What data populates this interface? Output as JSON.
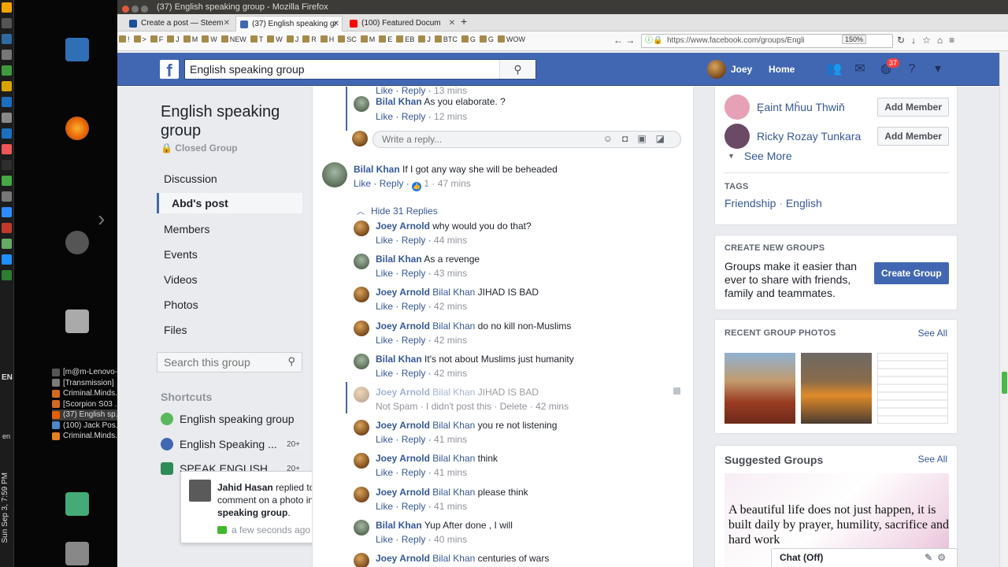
{
  "os": {
    "clock": "Sun Sep 3, 7:59 PM",
    "language": "EN",
    "lang_small": "en",
    "taskbar": [
      {
        "label": "[m@m-Lenovo-...",
        "color": "#555555"
      },
      {
        "label": "[Transmission]",
        "color": "#7a7a7a"
      },
      {
        "label": "Criminal.Minds...",
        "color": "#d2691e"
      },
      {
        "label": "[Scorpion S03 ...",
        "color": "#d2691e"
      },
      {
        "label": "(37) English sp...",
        "color": "#e66000"
      },
      {
        "label": "(100) Jack Pos...",
        "color": "#4f86c6"
      },
      {
        "label": "Criminal.Minds...",
        "color": "#e67e22"
      }
    ]
  },
  "window": {
    "title": "(37) English speaking group - Mozilla Firefox"
  },
  "tabs": [
    {
      "label": "Create a post — Steem",
      "color": "#1a5099"
    },
    {
      "label": "(37) English speaking gr",
      "color": "#4267b2"
    },
    {
      "label": "(100) Featured Docum",
      "color": "#ff0000"
    }
  ],
  "bookmarks": [
    "!",
    ">",
    "F",
    "J",
    "M",
    "W",
    "NEW",
    "T",
    "W",
    "J",
    "R",
    "H",
    "SC",
    "M",
    "E",
    "EB",
    "J",
    "BTC",
    "G",
    "G",
    "WOW"
  ],
  "url": "https://www.facebook.com/groups/Engli",
  "zoom": "150%",
  "fb": {
    "logo": "f",
    "search_value": "English speaking group",
    "user_name": "Joey",
    "home_label": "Home",
    "notifications_count": "37"
  },
  "group": {
    "name": "English speaking group",
    "type": "Closed Group",
    "nav": [
      "Discussion",
      "Abd's post",
      "Members",
      "Events",
      "Videos",
      "Photos",
      "Files"
    ],
    "active_nav": "Abd's post",
    "search_placeholder": "Search this group",
    "shortcuts_title": "Shortcuts",
    "shortcuts": [
      {
        "label": "English speaking group",
        "count": ""
      },
      {
        "label": "English Speaking ...",
        "count": "20+"
      },
      {
        "label": "SPEAK ENGLISH ...",
        "count": "20+"
      }
    ]
  },
  "notification": {
    "actor": "Jahid Hasan",
    "text": " replied to your comment on a photo in ",
    "target": "English speaking group",
    "suffix": ".",
    "time": "a few seconds ago"
  },
  "comments": {
    "top_like": "Like",
    "top_reply": "Reply",
    "top_time": "13 mins",
    "first": {
      "name": "Bilal Khan",
      "text": "As you elaborate. ?",
      "like": "Like",
      "reply": "Reply",
      "time": "12 mins"
    },
    "reply_placeholder": "Write a reply...",
    "main": {
      "name": "Bilal Khan",
      "text": "If I got any way she will be beheaded",
      "like": "Like",
      "reply": "Reply",
      "likes": "1",
      "time": "47 mins"
    },
    "hide_replies": "Hide 31 Replies",
    "replies": [
      {
        "name": "Joey Arnold",
        "tag": "",
        "text": "why would you do that?",
        "a1": "Like",
        "a2": "Reply",
        "a3": "",
        "time": "44 mins",
        "who": "joey"
      },
      {
        "name": "Bilal Khan",
        "tag": "",
        "text": "As a revenge",
        "a1": "Like",
        "a2": "Reply",
        "a3": "",
        "time": "43 mins",
        "who": "bilal"
      },
      {
        "name": "Joey Arnold",
        "tag": "Bilal Khan",
        "text": "JIHAD IS BAD",
        "a1": "Like",
        "a2": "Reply",
        "a3": "",
        "time": "42 mins",
        "who": "joey"
      },
      {
        "name": "Joey Arnold",
        "tag": "Bilal Khan",
        "text": "do no kill non-Muslims",
        "a1": "Like",
        "a2": "Reply",
        "a3": "",
        "time": "42 mins",
        "who": "joey"
      },
      {
        "name": "Bilal Khan",
        "tag": "",
        "text": "It's not about Muslims just humanity",
        "a1": "Like",
        "a2": "Reply",
        "a3": "",
        "time": "42 mins",
        "who": "bilal"
      },
      {
        "name": "Joey Arnold",
        "tag": "Bilal Khan",
        "text": "JIHAD IS BAD",
        "a1": "Not Spam",
        "a2": "I didn't post this",
        "a3": "Delete",
        "time": "42 mins",
        "who": "joey",
        "hidden": true
      },
      {
        "name": "Joey Arnold",
        "tag": "Bilal Khan",
        "text": "you re not listening",
        "a1": "Like",
        "a2": "Reply",
        "a3": "",
        "time": "41 mins",
        "who": "joey"
      },
      {
        "name": "Joey Arnold",
        "tag": "Bilal Khan",
        "text": "think",
        "a1": "Like",
        "a2": "Reply",
        "a3": "",
        "time": "41 mins",
        "who": "joey"
      },
      {
        "name": "Joey Arnold",
        "tag": "Bilal Khan",
        "text": "please think",
        "a1": "Like",
        "a2": "Reply",
        "a3": "",
        "time": "41 mins",
        "who": "joey"
      },
      {
        "name": "Bilal Khan",
        "tag": "",
        "text": "Yup After done , I will",
        "a1": "Like",
        "a2": "Reply",
        "a3": "",
        "time": "40 mins",
        "who": "bilal"
      },
      {
        "name": "Joey Arnold",
        "tag": "Bilal Khan",
        "text": "centuries of wars",
        "a1": "",
        "a2": "",
        "a3": "",
        "time": "",
        "who": "joey"
      }
    ]
  },
  "right": {
    "members": [
      {
        "name": "Ȩaint Mȟuu Thwiň",
        "button": "Add Member",
        "color": "#e7a1b6"
      },
      {
        "name": "Ricky Rozay Tunkara",
        "button": "Add Member",
        "color": "#6b4a66"
      }
    ],
    "see_more": "See More",
    "tags_title": "TAGS",
    "tags": [
      "Friendship",
      "English"
    ],
    "create_title": "CREATE NEW GROUPS",
    "create_text": "Groups make it easier than ever to share with friends, family and teammates.",
    "create_button": "Create Group",
    "photos_title": "RECENT GROUP PHOTOS",
    "photos_see_all": "See All",
    "suggested_title": "Suggested Groups",
    "suggested_see_all": "See All",
    "suggested_quote": "A beautiful life does not just happen, it is built daily by prayer, humility, sacrifice and hard work",
    "chat_label": "Chat (Off)"
  }
}
